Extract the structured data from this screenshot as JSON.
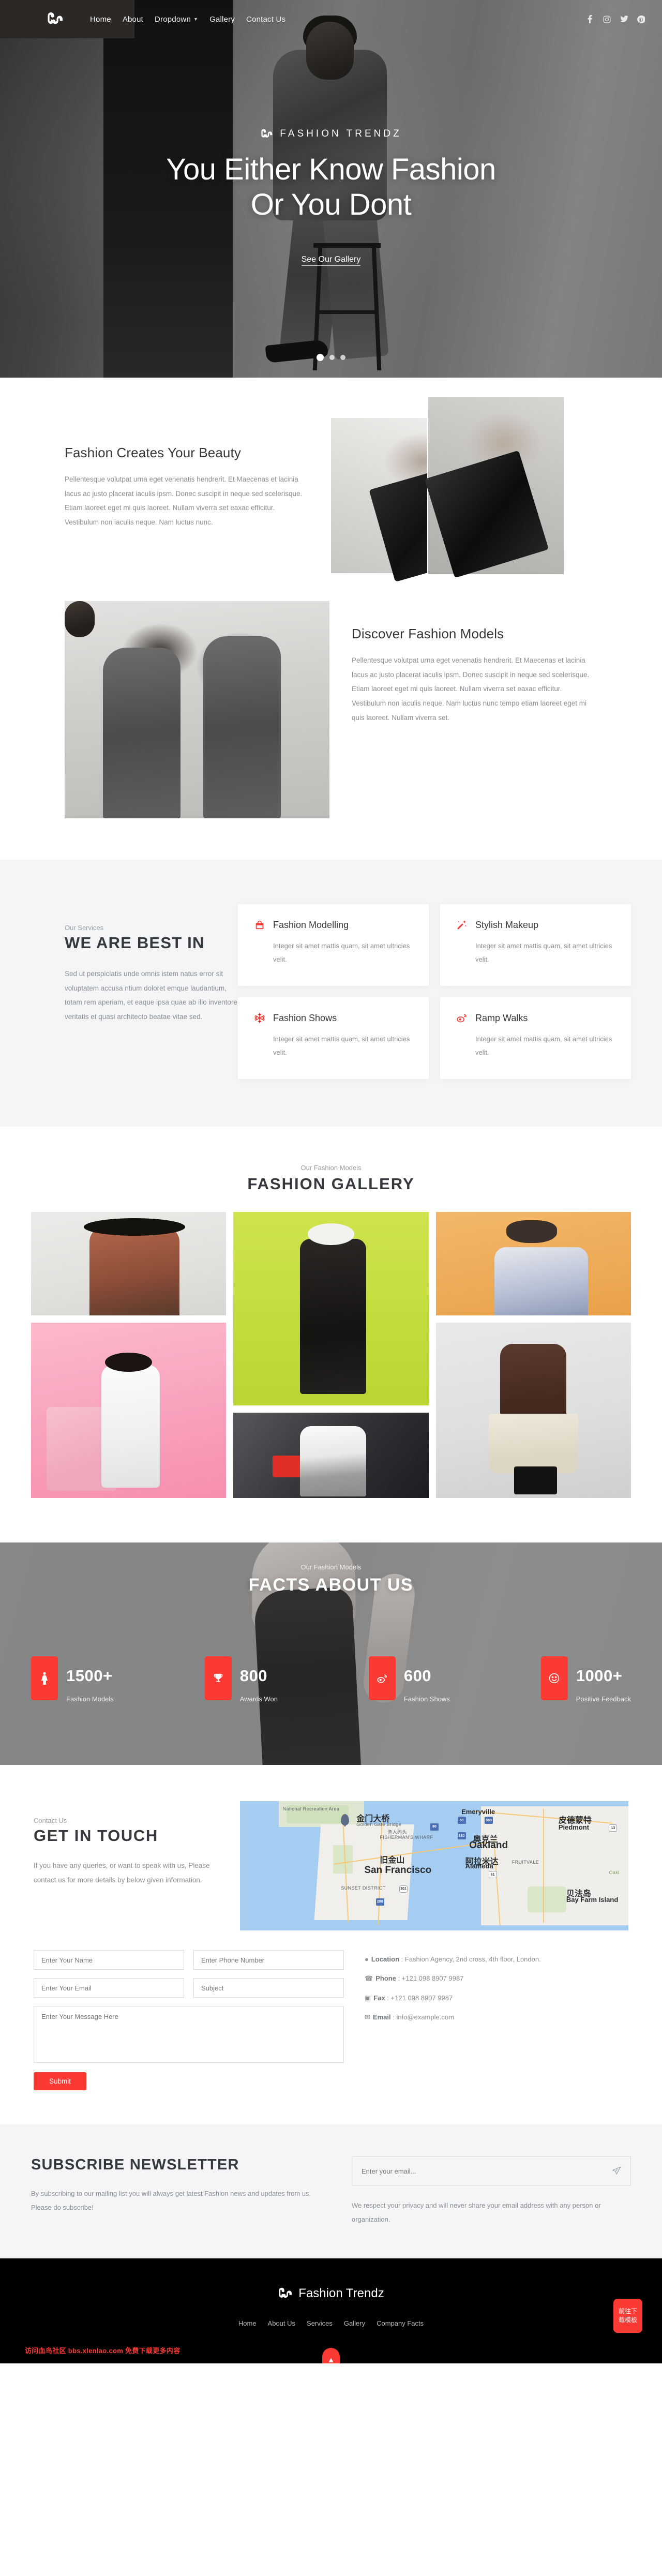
{
  "brand": {
    "name": "Fashion Trendz",
    "logo_icon": "stumbleupon-logo-icon",
    "accent_color": "#fc3a34"
  },
  "nav": {
    "items": [
      {
        "label": "Home",
        "icon": ""
      },
      {
        "label": "About",
        "icon": ""
      },
      {
        "label": "Dropdown",
        "icon": "chevron-down-icon"
      },
      {
        "label": "Gallery",
        "icon": ""
      },
      {
        "label": "Contact Us",
        "icon": ""
      }
    ],
    "social": [
      {
        "name": "facebook-icon",
        "glyph": "f"
      },
      {
        "name": "instagram-icon",
        "glyph": "□"
      },
      {
        "name": "twitter-icon",
        "glyph": "ᴠ"
      },
      {
        "name": "pinterest-icon",
        "glyph": "P"
      }
    ]
  },
  "hero": {
    "brand_label": "FASHION TRENDZ",
    "title_line1": "You Either Know Fashion",
    "title_line2": "Or You Dont",
    "cta": "See Our Gallery",
    "slides": 3,
    "active_slide": 1
  },
  "about": {
    "block1": {
      "heading": "Fashion Creates Your Beauty",
      "paragraph": "Pellentesque volutpat urna eget venenatis hendrerit. Et Maecenas et lacinia lacus ac justo placerat iaculis ipsm. Donec suscipit in neque sed scelerisque. Etiam laoreet eget mi quis laoreet. Nullam viverra set eaxac efficitur. Vestibulum non iaculis neque. Nam luctus nunc."
    },
    "block2": {
      "heading": "Discover Fashion Models",
      "paragraph": "Pellentesque volutpat urna eget venenatis hendrerit. Et Maecenas et lacinia lacus ac justo placerat iaculis ipsm. Donec suscipit in neque sed scelerisque. Etiam laoreet eget mi quis laoreet. Nullam viverra set eaxac efficitur. Vestibulum non iaculis neque. Nam luctus nunc tempo etiam laoreet eget mi quis laoreet. Nullam viverra set."
    }
  },
  "services": {
    "eyebrow": "Our Services",
    "title": "WE ARE BEST IN",
    "paragraph": "Sed ut perspiciatis unde omnis istem natus error sit voluptatem accusa ntium doloret emque laudantium, totam rem aperiam, et eaque ipsa quae ab illo inventore veritatis et quasi architecto beatae vitae sed.",
    "cards": [
      {
        "icon": "shopping-bag-icon",
        "title": "Fashion Modelling",
        "desc": "Integer sit amet mattis quam, sit amet ultricies velit."
      },
      {
        "icon": "magic-wand-icon",
        "title": "Stylish Makeup",
        "desc": "Integer sit amet mattis quam, sit amet ultricies velit."
      },
      {
        "icon": "snowflake-icon",
        "title": "Fashion Shows",
        "desc": "Integer sit amet mattis quam, sit amet ultricies velit."
      },
      {
        "icon": "weibo-icon",
        "title": "Ramp Walks",
        "desc": "Integer sit amet mattis quam, sit amet ultricies velit."
      }
    ]
  },
  "gallery": {
    "eyebrow": "Our Fashion Models",
    "title": "FASHION GALLERY",
    "items": [
      {
        "name": "gallery-image-1",
        "bg": "#e7e5e2"
      },
      {
        "name": "gallery-image-2",
        "bg": "#c4dd3e"
      },
      {
        "name": "gallery-image-3",
        "bg": "#eeab58"
      },
      {
        "name": "gallery-image-4",
        "bg": "#f9a3bd"
      },
      {
        "name": "gallery-image-5",
        "bg": "#2f3134"
      },
      {
        "name": "gallery-image-6",
        "bg": "#dedede"
      }
    ]
  },
  "facts": {
    "eyebrow": "Our Fashion Models",
    "title": "FACTS ABOUT US",
    "items": [
      {
        "icon": "model-person-icon",
        "number": "1500+",
        "label": "Fashion Models"
      },
      {
        "icon": "trophy-icon",
        "number": "800",
        "label": "Awards Won"
      },
      {
        "icon": "weibo-icon",
        "number": "600",
        "label": "Fashion Shows"
      },
      {
        "icon": "smiley-icon",
        "number": "1000+",
        "label": "Positive Feedback"
      }
    ]
  },
  "contact": {
    "eyebrow": "Contact Us",
    "title": "GET IN TOUCH",
    "paragraph": "If you have any queries, or want to speak with us, Please contact us for more details by below given information.",
    "map": {
      "labels": [
        {
          "text": "National Recreation Area",
          "kind": "sm"
        },
        {
          "text": "金门大桥",
          "kind": "cn"
        },
        {
          "text": "Golden Gate Bridge",
          "kind": "sm"
        },
        {
          "text": "渔人码头",
          "kind": "sm"
        },
        {
          "text": "FISHERMAN'S WHARF",
          "kind": "sm"
        },
        {
          "text": "Emeryville",
          "kind": "md"
        },
        {
          "text": "皮德蒙特",
          "kind": "cn"
        },
        {
          "text": "Piedmont",
          "kind": "md"
        },
        {
          "text": "奥克兰",
          "kind": "cn"
        },
        {
          "text": "Oakland",
          "kind": "big"
        },
        {
          "text": "阿拉米达",
          "kind": "cn"
        },
        {
          "text": "Alameda",
          "kind": "md"
        },
        {
          "text": "FRUITVALE",
          "kind": "sm"
        },
        {
          "text": "旧金山",
          "kind": "cn"
        },
        {
          "text": "San Francisco",
          "kind": "big"
        },
        {
          "text": "SUNSET DISTRICT",
          "kind": "sm"
        },
        {
          "text": "贝法岛",
          "kind": "cn"
        },
        {
          "text": "Bay Farm Island",
          "kind": "md"
        },
        {
          "text": "Oakl",
          "kind": "sm"
        }
      ],
      "shields": [
        "80",
        "80",
        "580",
        "880",
        "13",
        "61",
        "101",
        "280"
      ]
    },
    "form": {
      "name_placeholder": "Enter Your Name",
      "phone_placeholder": "Enter Phone Number",
      "email_placeholder": "Enter Your Email",
      "subject_placeholder": "Subject",
      "message_placeholder": "Enter Your Message Here",
      "submit_label": "Submit"
    },
    "info": [
      {
        "icon": "map-pin-icon",
        "label": "Location",
        "value": "Fashion Agency, 2nd cross, 4th floor, London."
      },
      {
        "icon": "phone-icon",
        "label": "Phone",
        "value": "+121 098 8907 9987"
      },
      {
        "icon": "fax-icon",
        "label": "Fax",
        "value": "+121 098 8907 9987"
      },
      {
        "icon": "envelope-icon",
        "label": "Email",
        "value": "info@example.com"
      }
    ]
  },
  "newsletter": {
    "title": "SUBSCRIBE NEWSLETTER",
    "subtitle": "By subscribing to our mailing list you will always get latest Fashion news and updates from us. Please do subscribe!",
    "email_placeholder": "Enter your email...",
    "send_icon": "paper-plane-icon",
    "note": "We respect your privacy and will never share your email address with any person or organization."
  },
  "footer": {
    "brand": "Fashion Trendz",
    "links": [
      "Home",
      "About Us",
      "Services",
      "Gallery",
      "Company Facts"
    ],
    "watermark": "访问血鸟社区 bbs.xlenlao.com 免费下载更多内容",
    "download_badge": "前往下载模板",
    "to_top_icon": "arrow-up-icon"
  }
}
